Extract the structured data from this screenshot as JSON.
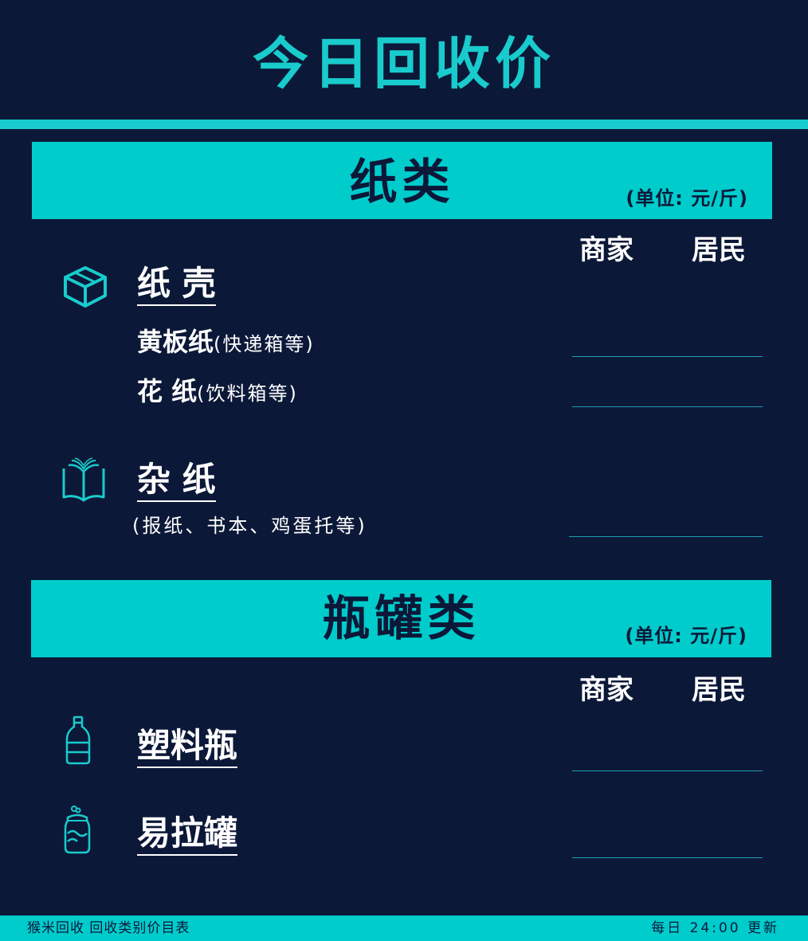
{
  "title": "今日回收价",
  "paper": {
    "header": "纸类",
    "unit": "(单位: 元/斤)",
    "col_merchant": "商家",
    "col_resident": "居民",
    "cardboard": {
      "title": "纸 壳",
      "items": [
        {
          "name": "黄板纸",
          "note": "(快递箱等)"
        },
        {
          "name": "花 纸",
          "note": "(饮料箱等)"
        }
      ]
    },
    "mixed": {
      "title": "杂 纸",
      "note": "(报纸、书本、鸡蛋托等)"
    }
  },
  "bottles": {
    "header": "瓶罐类",
    "unit": "(单位: 元/斤)",
    "col_merchant": "商家",
    "col_resident": "居民",
    "items": [
      {
        "name": "塑料瓶",
        "icon": "plastic-bottle-icon"
      },
      {
        "name": "易拉罐",
        "icon": "soda-can-icon"
      }
    ]
  },
  "footer": {
    "left": "猴米回收 回收类别价目表",
    "right": "每日 24:00 更新"
  },
  "colors": {
    "background": "#0c1838",
    "accent": "#00cccc"
  }
}
